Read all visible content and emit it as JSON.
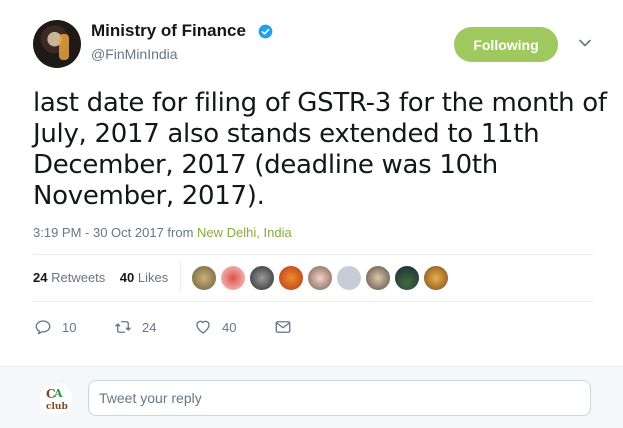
{
  "header": {
    "name": "Ministry of Finance",
    "handle": "@FinMinIndia",
    "follow_label": "Following"
  },
  "tweet": {
    "text": "last date for filing of GSTR-3 for the month of\nJuly, 2017 also stands extended to 11th\nDecember, 2017  (deadline was 10th\nNovember, 2017).",
    "time": "3:19 PM - 30 Oct 2017 from ",
    "location": "New Delhi, India"
  },
  "stats": {
    "retweets_count": "24",
    "retweets_label": "Retweets",
    "likes_count": "40",
    "likes_label": "Likes"
  },
  "actions": {
    "replies": "10",
    "retweets": "24",
    "likes": "40"
  },
  "reply": {
    "placeholder": "Tweet your reply"
  },
  "colors": {
    "follow_button": "#9fc85e",
    "location_link": "#8aa840",
    "verified_badge": "#1da1f2"
  },
  "icons": [
    "verified-icon",
    "chevron-down-icon",
    "reply-icon",
    "retweet-icon",
    "heart-icon",
    "dm-icon"
  ]
}
